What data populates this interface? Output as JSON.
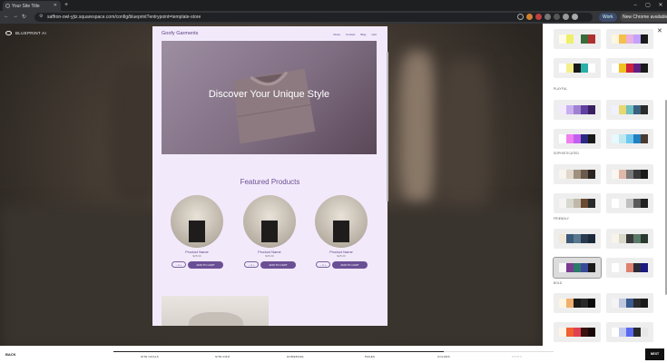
{
  "browser": {
    "tab_title": "Your Site Title",
    "url": "saffron-owl-yjtz.squarespace.com/config/blueprint?entrypoint=template-store",
    "work_label": "Work",
    "update_label": "New Chrome available"
  },
  "app": {
    "logo_label": "BLUEPRINT AI"
  },
  "site": {
    "title": "Goofy Garments",
    "nav": [
      "About",
      "Contact",
      "Blog",
      "Cart"
    ],
    "hero_text": "Discover Your Unique Style",
    "featured_heading": "Featured Products",
    "products": [
      {
        "name": "Product Name",
        "price": "$25.00",
        "qty": "1",
        "cart": "ADD TO CART"
      },
      {
        "name": "Product Name",
        "price": "$25.00",
        "qty": "1",
        "cart": "ADD TO CART"
      },
      {
        "name": "Product Name",
        "price": "$25.00",
        "qty": "1",
        "cart": "ADD TO CART"
      }
    ]
  },
  "panel": {
    "sections": [
      "PLAYFUL",
      "SOPHISTICATED",
      "FRIENDLY",
      "BOLD"
    ],
    "palettes": [
      [
        "#fffbe8",
        "#eef06a",
        "#f0f0f0",
        "#3a6b3a",
        "#b03030"
      ],
      [
        "#fff6e0",
        "#f5c04a",
        "#e9b0e0",
        "#c4a0ff",
        "#1a1a1a"
      ],
      [
        "#ffffff",
        "#f5f08a",
        "#1a1a1a",
        "#2bb0a8",
        "#ffffff"
      ],
      [
        "#ffffff",
        "#f0c020",
        "#d02040",
        "#602080",
        "#1a1a1a"
      ],
      [
        "#f4eaff",
        "#c8b0f0",
        "#a080d0",
        "#6040a0",
        "#3a2060"
      ],
      [
        "#f0f0ff",
        "#e8d870",
        "#6fc0c0",
        "#3a6080",
        "#2a2a2a"
      ],
      [
        "#ffffff",
        "#f080f0",
        "#c060f0",
        "#2a2a80",
        "#1a1a1a"
      ],
      [
        "#e8f8ff",
        "#c0e8f0",
        "#70c8f0",
        "#2080c0",
        "#4a3a30"
      ],
      [
        "#f8f4ee",
        "#e0d8cc",
        "#a09080",
        "#6a5a4c",
        "#2a2420"
      ],
      [
        "#fbf6f0",
        "#e0b8a8",
        "#7a7a7a",
        "#3a3a3a",
        "#1a1a1a"
      ],
      [
        "#f4f4f2",
        "#d8d8d0",
        "#c0b8a8",
        "#6a4a30",
        "#2a2a2a"
      ],
      [
        "#ffffff",
        "#f0f0f0",
        "#c0c0c0",
        "#5a5a5a",
        "#202020"
      ],
      [
        "#f0e8d8",
        "#3a5a78",
        "#5a7890",
        "#2a3a50",
        "#1a2a3a"
      ],
      [
        "#f8f4ea",
        "#d8d8c8",
        "#3a3a3a",
        "#5a7a6a",
        "#2a3a30"
      ],
      [
        "#f8f8f8",
        "#7a3a90",
        "#2a7a6a",
        "#3a4a9a",
        "#1a1a1a"
      ],
      [
        "#ffffff",
        "#f0f0f0",
        "#e08070",
        "#2a2a3a",
        "#1a1a80"
      ],
      [
        "#fff4e0",
        "#f0b070",
        "#1a1a1a",
        "#2a2a2a",
        "#0a0a0a"
      ],
      [
        "#f4f4f4",
        "#c0c8e0",
        "#3a5a90",
        "#2a2a2a",
        "#1a1a1a"
      ],
      [
        "#fff4e8",
        "#f06030",
        "#e04050",
        "#3a1010",
        "#1a0808"
      ],
      [
        "#ffffff",
        "#c0c8f0",
        "#5a6af0",
        "#2a2a2a",
        "#e8e8e8"
      ]
    ]
  },
  "footer": {
    "back": "BACK",
    "next": "NEXT",
    "progress": 0.75,
    "steps": [
      "SITE GOALS",
      "SITE INFO",
      "HOMEPAGE",
      "PAGES",
      "COLORS",
      "FONTS"
    ]
  }
}
